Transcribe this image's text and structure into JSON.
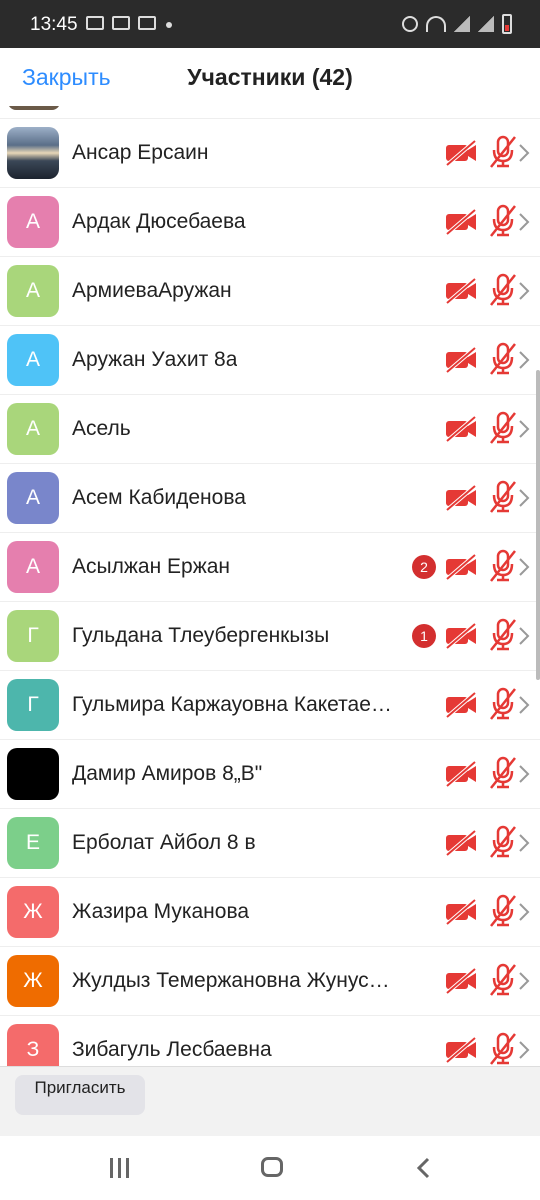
{
  "status_bar": {
    "time": "13:45",
    "icons": [
      "image-icon",
      "youtube-icon",
      "screen-record-icon",
      "alarm-icon",
      "wifi-icon",
      "signal-icon",
      "battery-low-icon"
    ]
  },
  "header": {
    "close_label": "Закрыть",
    "title": "Участники (42)"
  },
  "participants": [
    {
      "name": "Ансар Ерсаин",
      "avatar_letter": "",
      "avatar_color": "photo",
      "unread": ""
    },
    {
      "name": "Ардак Дюсебаева",
      "avatar_letter": "А",
      "avatar_color": "#e57fae",
      "unread": ""
    },
    {
      "name": "АрмиеваАружан",
      "avatar_letter": "А",
      "avatar_color": "#a9d67b",
      "unread": ""
    },
    {
      "name": "Аружан Уахит 8а",
      "avatar_letter": "А",
      "avatar_color": "#4fc3f7",
      "unread": ""
    },
    {
      "name": "Асель",
      "avatar_letter": "А",
      "avatar_color": "#a9d67b",
      "unread": ""
    },
    {
      "name": "Асем Кабиденова",
      "avatar_letter": "А",
      "avatar_color": "#7986cb",
      "unread": ""
    },
    {
      "name": "Асылжан Ержан",
      "avatar_letter": "А",
      "avatar_color": "#e57fae",
      "unread": "2"
    },
    {
      "name": "Гульдана Тлеубергенкызы",
      "avatar_letter": "Г",
      "avatar_color": "#a9d67b",
      "unread": "1"
    },
    {
      "name": "Гульмира Каржауовна Какетае…",
      "avatar_letter": "Г",
      "avatar_color": "#4db6ac",
      "unread": ""
    },
    {
      "name": "Дамир Амиров  8„В\"",
      "avatar_letter": "",
      "avatar_color": "#000000",
      "unread": ""
    },
    {
      "name": "Ерболат Айбол 8 в",
      "avatar_letter": "Е",
      "avatar_color": "#7ccf8a",
      "unread": ""
    },
    {
      "name": "Жазира Муканова",
      "avatar_letter": "Ж",
      "avatar_color": "#f46b6b",
      "unread": ""
    },
    {
      "name": "Жулдыз Темержановна Жунус…",
      "avatar_letter": "Ж",
      "avatar_color": "#ef6c00",
      "unread": ""
    },
    {
      "name": "Зибагуль Лесбаевна",
      "avatar_letter": "З",
      "avatar_color": "#f46b6b",
      "unread": ""
    }
  ],
  "footer": {
    "invite_label": "Пригласить"
  },
  "colors": {
    "accent": "#2d8cff",
    "muted_red": "#e53935"
  }
}
